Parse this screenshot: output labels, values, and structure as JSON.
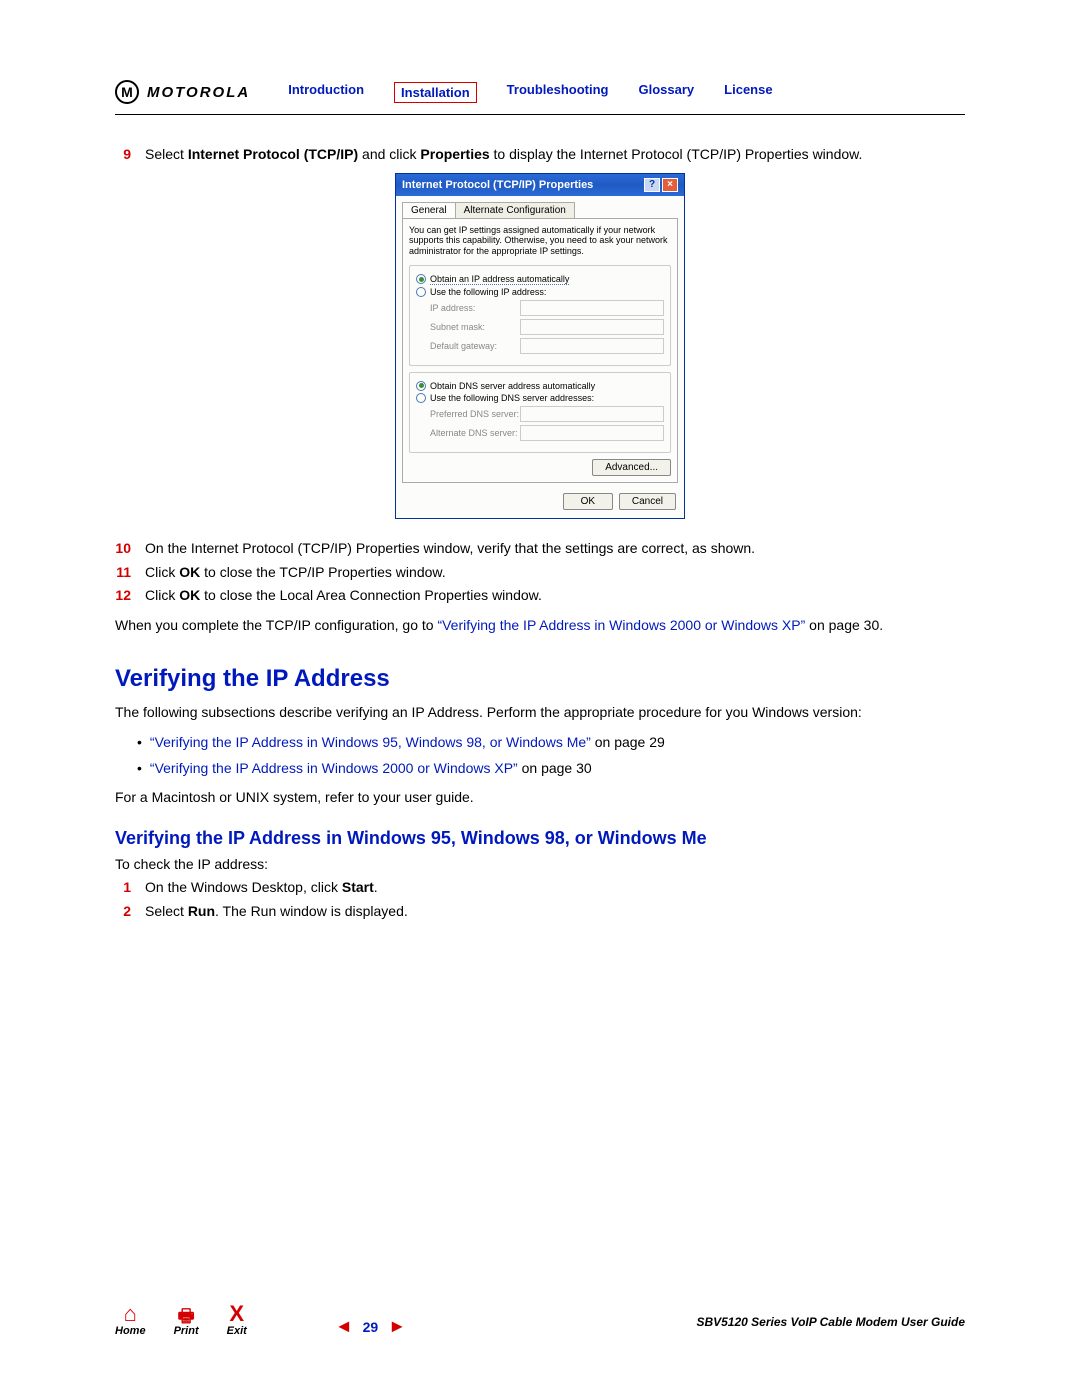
{
  "brand": "MOTOROLA",
  "nav": {
    "intro": "Introduction",
    "install": "Installation",
    "trouble": "Troubleshooting",
    "glossary": "Glossary",
    "license": "License"
  },
  "steps": {
    "s9num": "9",
    "s9a": "Select ",
    "s9b": "Internet Protocol (TCP/IP)",
    "s9c": " and click ",
    "s9d": "Properties",
    "s9e": " to display the Internet Protocol (TCP/IP) Properties window.",
    "s10num": "10",
    "s10": "On the Internet Protocol (TCP/IP) Properties window, verify that the settings are correct, as shown.",
    "s11num": "11",
    "s11a": "Click ",
    "s11b": "OK",
    "s11c": " to close the TCP/IP Properties window.",
    "s12num": "12",
    "s12a": "Click ",
    "s12b": "OK",
    "s12c": " to close the Local Area Connection Properties window."
  },
  "dialog": {
    "title": "Internet Protocol (TCP/IP) Properties",
    "tab1": "General",
    "tab2": "Alternate Configuration",
    "desc": "You can get IP settings assigned automatically if your network supports this capability. Otherwise, you need to ask your network administrator for the appropriate IP settings.",
    "r1": "Obtain an IP address automatically",
    "r2": "Use the following IP address:",
    "f_ip": "IP address:",
    "f_subnet": "Subnet mask:",
    "f_gateway": "Default gateway:",
    "r3": "Obtain DNS server address automatically",
    "r4": "Use the following DNS server addresses:",
    "f_pdns": "Preferred DNS server:",
    "f_adns": "Alternate DNS server:",
    "btn_adv": "Advanced...",
    "btn_ok": "OK",
    "btn_cancel": "Cancel"
  },
  "para1a": "When you complete the TCP/IP configuration, go to ",
  "para1link": "“Verifying the IP Address in Windows 2000 or Windows XP”",
  "para1b": " on page 30.",
  "h2": "Verifying the IP Address",
  "para2": "The following subsections describe verifying an IP Address. Perform the appropriate procedure for you Windows version:",
  "bullet1link": "“Verifying the IP Address in Windows 95, Windows 98, or Windows Me”",
  "bullet1b": " on page 29",
  "bullet2link": "“Verifying the IP Address in Windows 2000 or Windows XP”",
  "bullet2b": " on page 30",
  "para3": "For a Macintosh or UNIX system, refer to your user guide.",
  "h3": "Verifying the IP Address in Windows 95, Windows 98, or Windows Me",
  "para4": "To check the IP address:",
  "sub1num": "1",
  "sub1a": "On the Windows Desktop, click ",
  "sub1b": "Start",
  "sub1c": ".",
  "sub2num": "2",
  "sub2a": "Select ",
  "sub2b": "Run",
  "sub2c": ". The Run window is displayed.",
  "footer": {
    "home": "Home",
    "print": "Print",
    "exit": "Exit",
    "page": "29",
    "doc": "SBV5120 Series VoIP Cable Modem User Guide"
  }
}
